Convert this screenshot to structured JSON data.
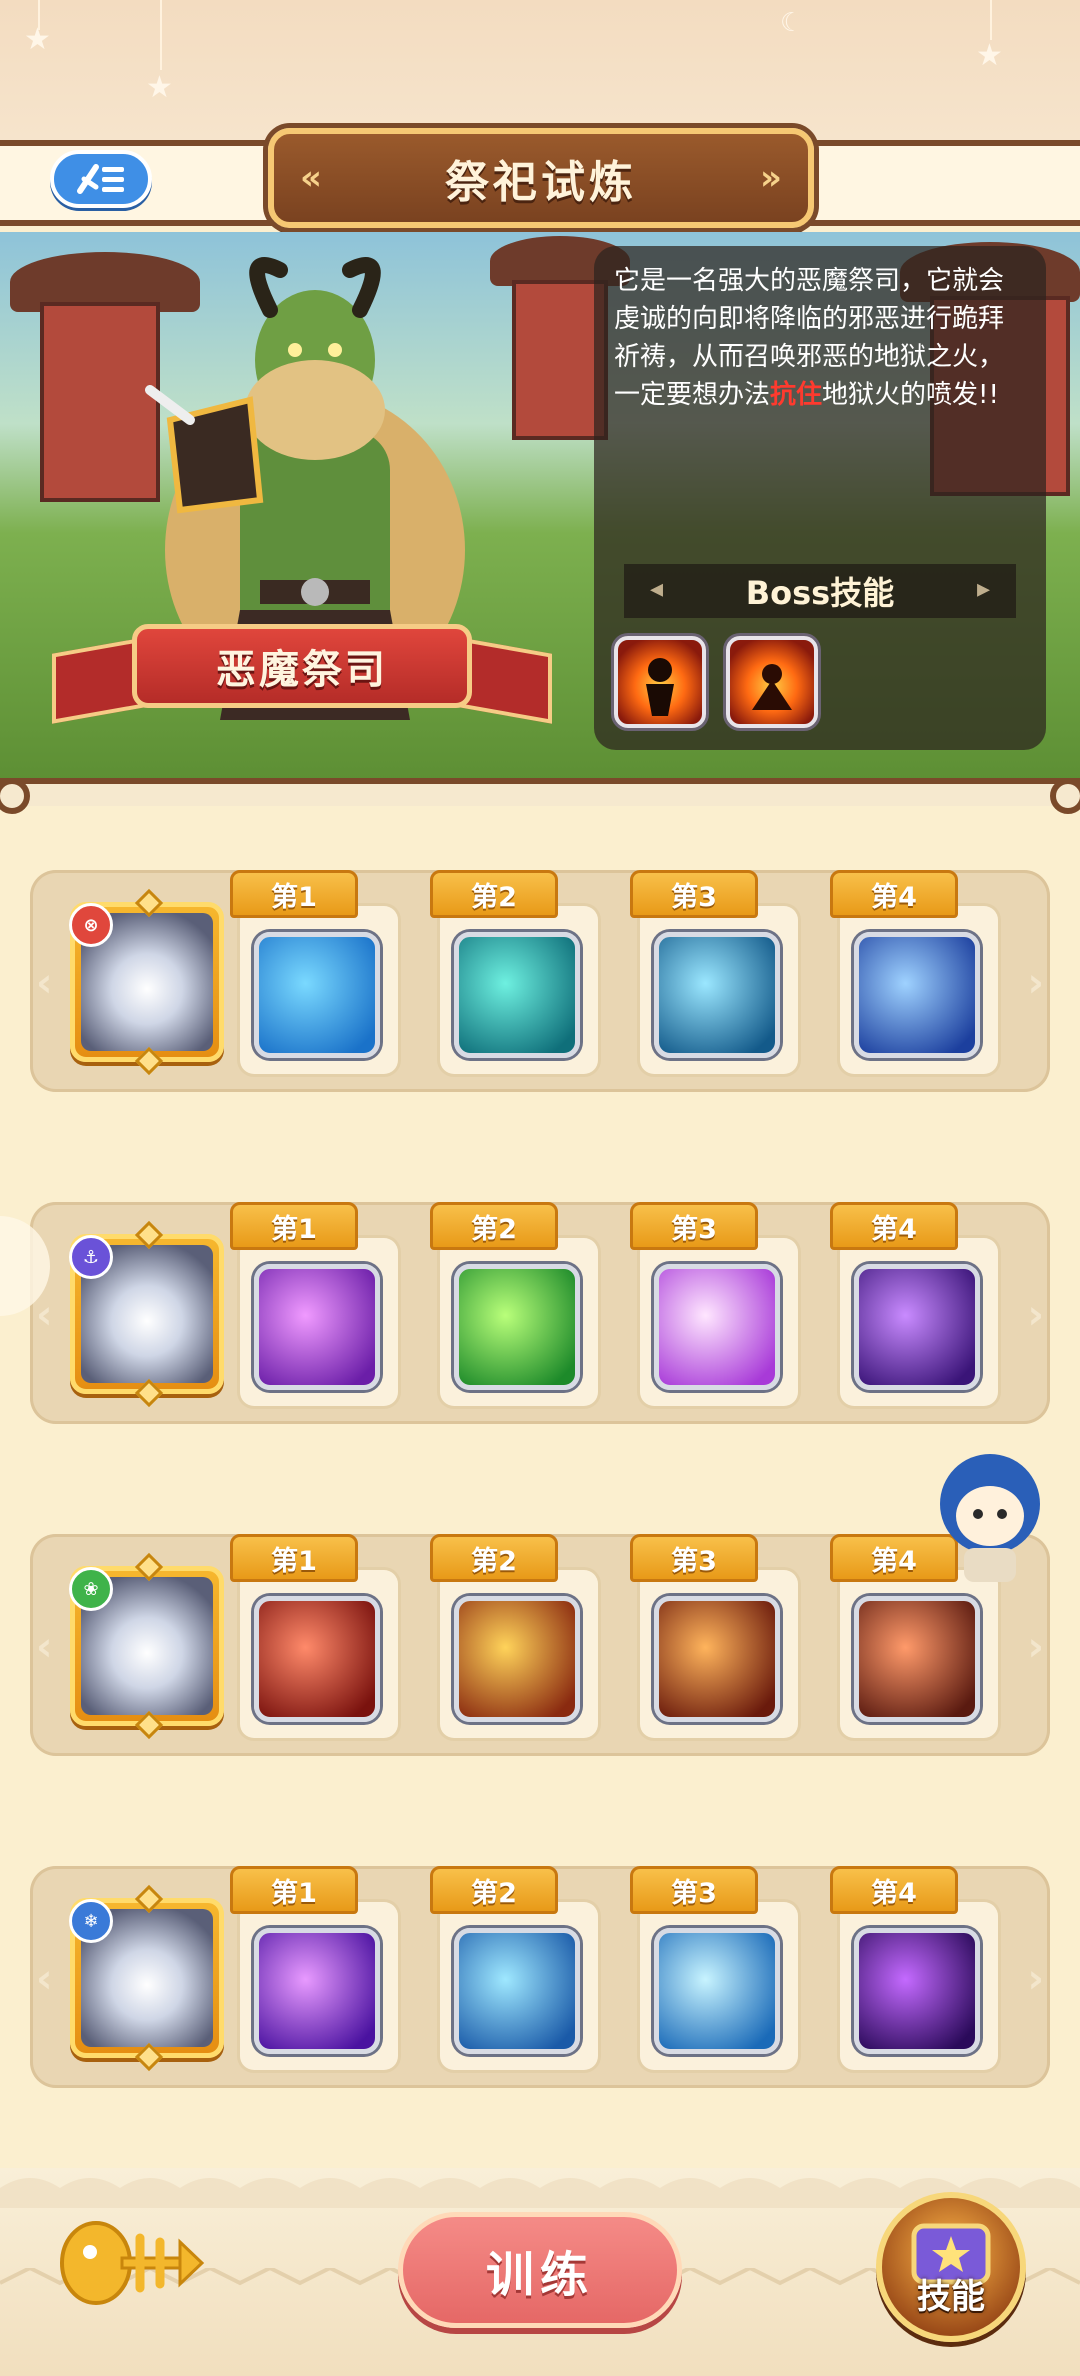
{
  "header": {
    "title": "祭祀试炼",
    "back_icon": "list-back-icon"
  },
  "boss": {
    "name": "恶魔祭司",
    "description_parts": [
      "它是一名强大的恶魔祭司，它就会虔诚的向即将降临的邪恶进行跪拜祈祷，从而召唤邪恶的地狱之火，一定要想办法",
      "抗住",
      "地狱火的喷发!!"
    ],
    "highlight_color": "#ff3a2e",
    "skills_title": "Boss技能",
    "skills": [
      {
        "icon": "fire-demon-icon"
      },
      {
        "icon": "fire-summon-icon"
      }
    ]
  },
  "teams": [
    {
      "hero": {
        "name": "armored-penguin",
        "badge_color": "#e0473c",
        "badge": "⊗"
      },
      "skills": [
        {
          "order": "第1",
          "icon": "ice-slash-icon",
          "colors": [
            "#7ad9ff",
            "#1a72c9"
          ]
        },
        {
          "order": "第2",
          "icon": "teal-ghost-icon",
          "colors": [
            "#6ef0e0",
            "#0f6f7a"
          ]
        },
        {
          "order": "第3",
          "icon": "hammer-icon",
          "colors": [
            "#9be7ff",
            "#135a8a"
          ]
        },
        {
          "order": "第4",
          "icon": "blue-blade-icon",
          "colors": [
            "#9fd2ff",
            "#1c3f9e"
          ]
        }
      ]
    },
    {
      "hero": {
        "name": "crowned-fish",
        "badge_color": "#6a52d8",
        "badge": "⚓"
      },
      "skills": [
        {
          "order": "第1",
          "icon": "purple-wave-icon",
          "colors": [
            "#f09aff",
            "#6b1ea8"
          ]
        },
        {
          "order": "第2",
          "icon": "green-heal-icon",
          "colors": [
            "#b9ff7a",
            "#1d8a2a"
          ]
        },
        {
          "order": "第3",
          "icon": "shield-wings-icon",
          "colors": [
            "#ffe6ff",
            "#a83ad8"
          ]
        },
        {
          "order": "第4",
          "icon": "purple-sprout-icon",
          "colors": [
            "#c98bff",
            "#3a1478"
          ]
        }
      ]
    },
    {
      "hero": {
        "name": "blue-fish",
        "badge_color": "#3fb34a",
        "badge": "❀"
      },
      "skills": [
        {
          "order": "第1",
          "icon": "mace-swing-icon",
          "colors": [
            "#ff8a6a",
            "#7a120e"
          ]
        },
        {
          "order": "第2",
          "icon": "campfire-icon",
          "colors": [
            "#ffd35a",
            "#8a2a10"
          ]
        },
        {
          "order": "第3",
          "icon": "claw-rays-icon",
          "colors": [
            "#ffb45c",
            "#6a1a0c"
          ]
        },
        {
          "order": "第4",
          "icon": "crossbow-icon",
          "colors": [
            "#ff9a6a",
            "#5a1a10"
          ]
        }
      ]
    },
    {
      "hero": {
        "name": "bandaged-bird",
        "badge_color": "#3a7ad8",
        "badge": "❄"
      },
      "skills": [
        {
          "order": "第1",
          "icon": "purple-arrows-icon",
          "colors": [
            "#e89aff",
            "#4a12a0"
          ]
        },
        {
          "order": "第2",
          "icon": "ice-shards-icon",
          "colors": [
            "#9fe8ff",
            "#1a5aa8"
          ]
        },
        {
          "order": "第3",
          "icon": "ice-arrow-icon",
          "colors": [
            "#c8f4ff",
            "#1a6ab8"
          ]
        },
        {
          "order": "第4",
          "icon": "dark-eye-icon",
          "colors": [
            "#c46aff",
            "#2a0a5a"
          ]
        }
      ]
    }
  ],
  "footer": {
    "fish_icon": "fishbone-icon",
    "train_label": "训练",
    "skill_label": "技能"
  }
}
